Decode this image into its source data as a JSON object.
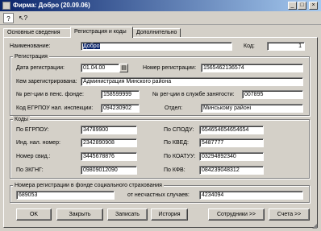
{
  "window": {
    "title": "Фирма: Добро (20.09.06)",
    "minimize": "_",
    "maximize": "□",
    "close": "×"
  },
  "toolbar": {
    "help_icon": "help-icon",
    "whatsthis_icon": "pointer-help-icon"
  },
  "tabs": [
    {
      "label": "Основные сведения"
    },
    {
      "label": "Регистрация и коды"
    },
    {
      "label": "Дополнительно"
    }
  ],
  "name_row": {
    "label": "Наименование:",
    "value": "Добро",
    "code_label": "Код:",
    "code_value": "1"
  },
  "registration": {
    "title": "Регистрация",
    "date_label": "Дата регистрации:",
    "date_value": "01.04.00",
    "number_label": "Номер регистрации:",
    "number_value": "1565462136574",
    "by_label": "Кем зарегистрирована:",
    "by_value": "Администрация Минского района",
    "pension_label": "№ рег-ции в пенс. фонде:",
    "pension_value": "158599999",
    "employment_label": "№ рег-ции в службе занятости:",
    "employment_value": "007895",
    "egrpou_insp_label": "Код ЕГРПОУ нал. инспекции:",
    "egrpou_insp_value": "094230902",
    "dept_label": "Отдел:",
    "dept_value": "Минському районі"
  },
  "codes": {
    "title": "Коды",
    "egrpou_label": "По ЕГРПОУ:",
    "egrpou_value": "34789900",
    "spodu_label": "По СПОДУ:",
    "spodu_value": "654654654654654",
    "tax_label": "Инд. нал. номер:",
    "tax_value": "2342890908",
    "kved_label": "По КВЕД:",
    "kved_value": "5487777",
    "cert_label": "Номер свид.:",
    "cert_value": "3445678876",
    "koatuu_label": "По КОАТУУ:",
    "koatuu_value": "03294892340",
    "zkgng_label": "По ЗКГНГ:",
    "zkgng_value": "09809012090",
    "kfv_label": "По КФВ:",
    "kfv_value": "084239048312"
  },
  "social": {
    "title": "Номера регистрации в фонде социального страхования",
    "value": "689053",
    "accident_label": "от несчастных случаев:",
    "accident_value": "4234094"
  },
  "buttons": {
    "ok": "OK",
    "close": "Закрыть",
    "save": "Записать",
    "history": "История",
    "employees": "Сотрудники >>",
    "accounts": "Счета >>"
  }
}
